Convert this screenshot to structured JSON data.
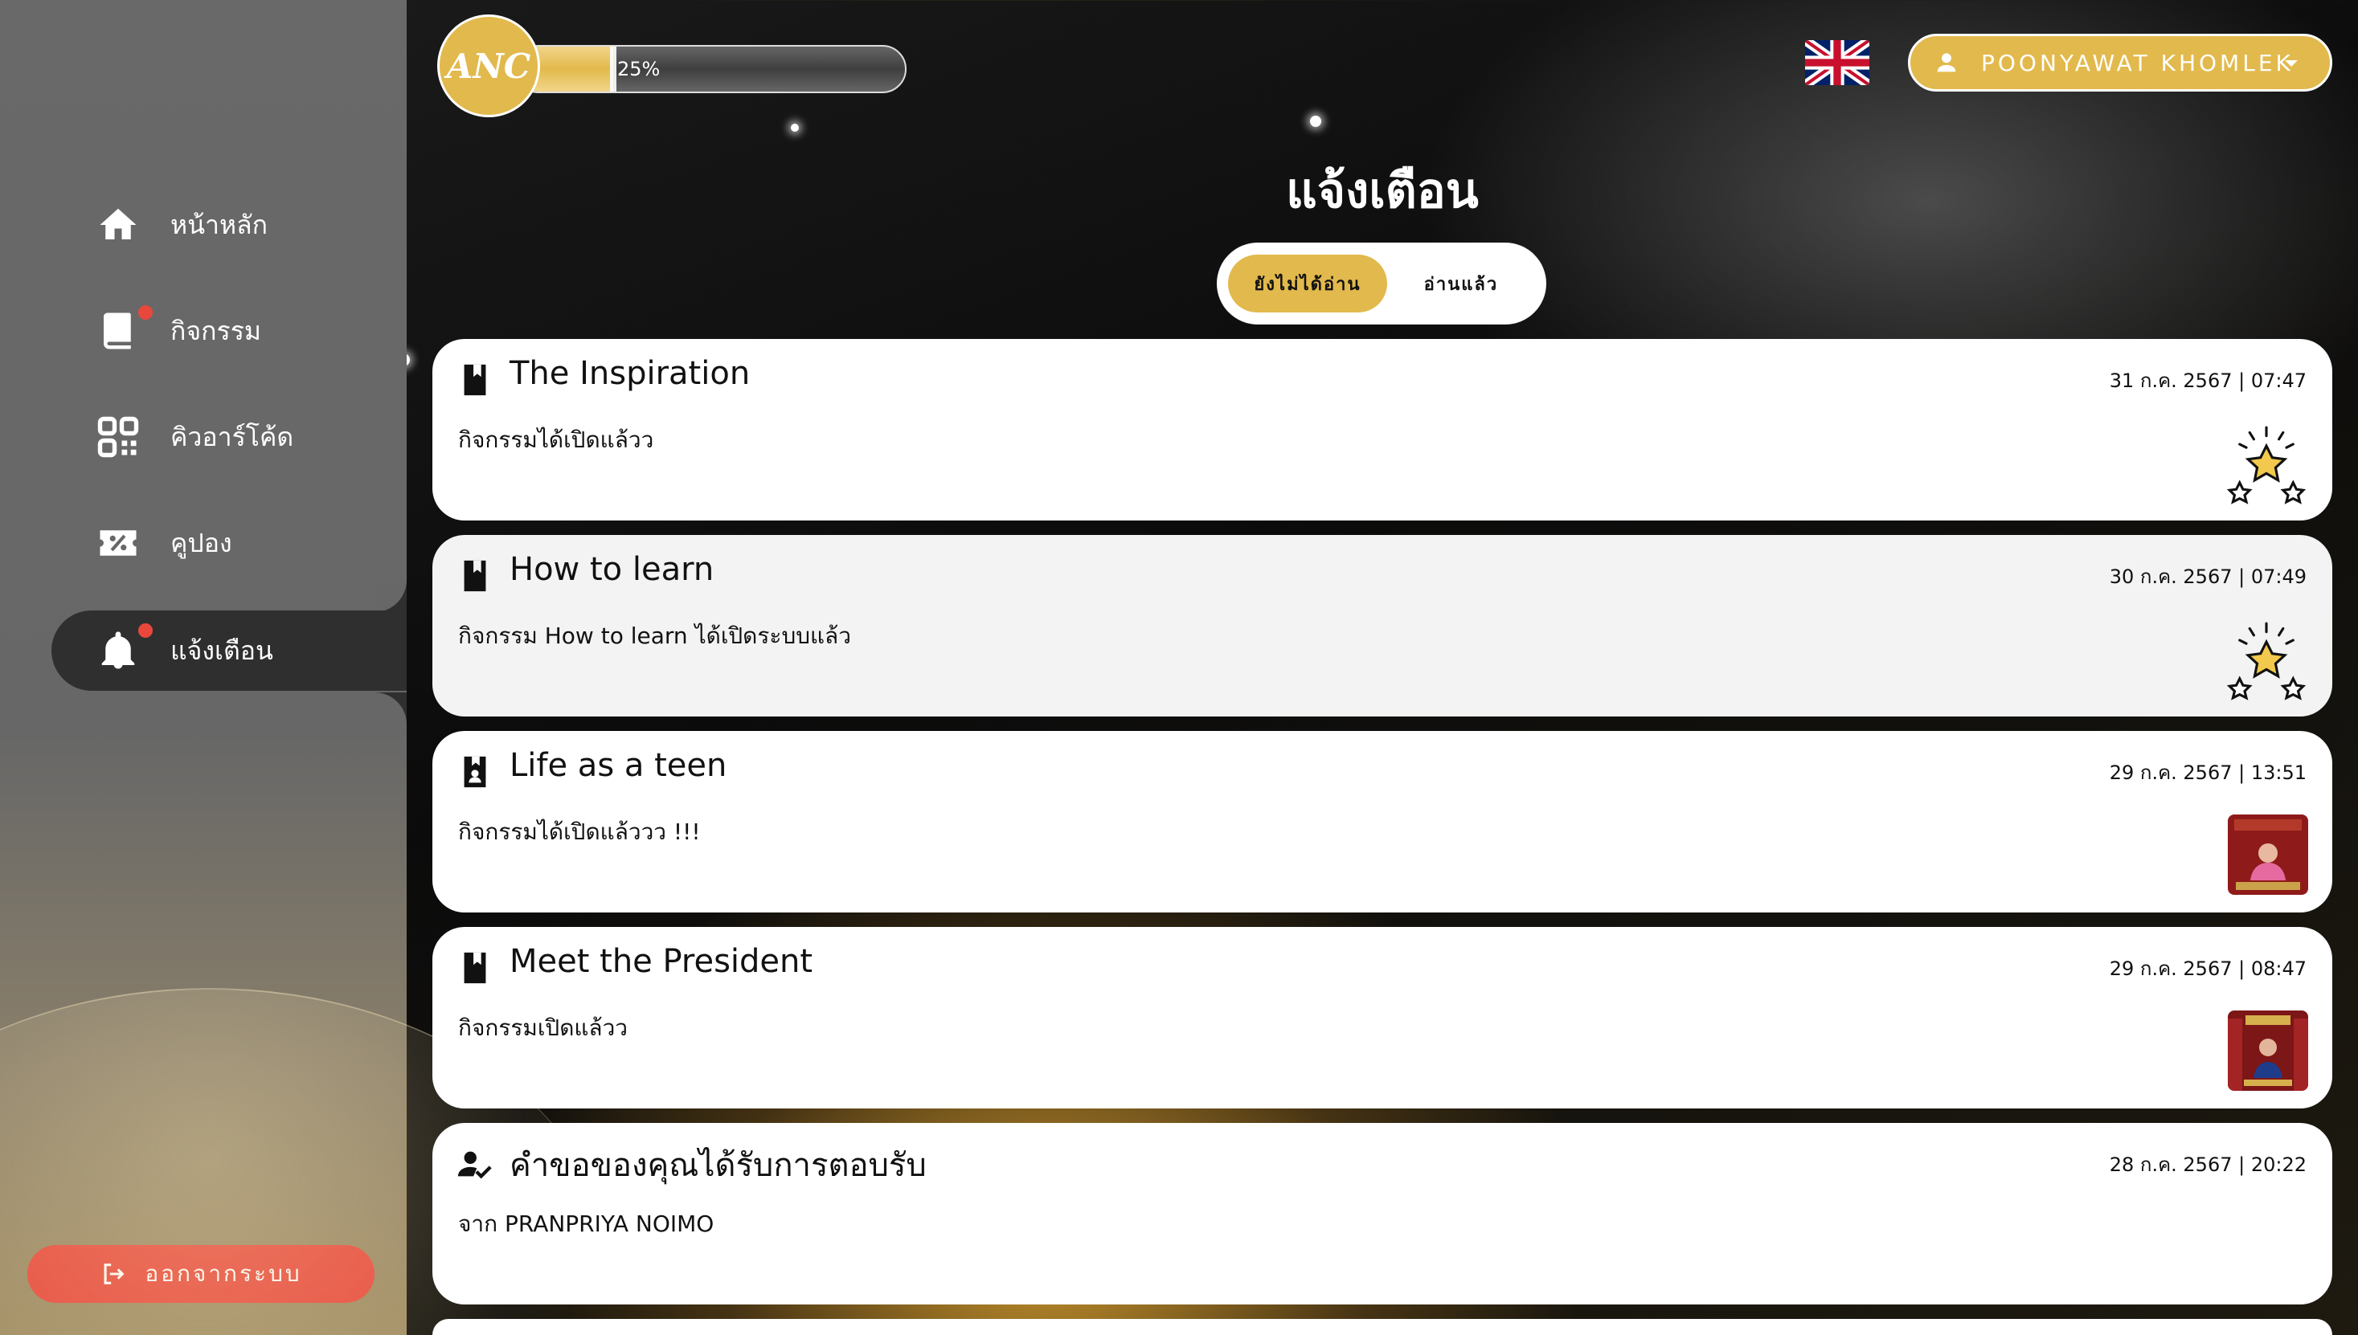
{
  "header": {
    "logo_text": "ANC",
    "progress_value": 0.25,
    "progress_label": "25%",
    "language_flag": "uk-flag-icon",
    "user_name": "POONYAWAT KHOMLEK"
  },
  "sidebar": {
    "items": [
      {
        "label": "หน้าหลัก",
        "icon": "home-icon"
      },
      {
        "label": "กิจกรรม",
        "icon": "book-icon",
        "badge": true
      },
      {
        "label": "คิวอาร์โค้ด",
        "icon": "qr-code-icon"
      },
      {
        "label": "คูปอง",
        "icon": "coupon-icon"
      },
      {
        "label": "แจ้งเตือน",
        "icon": "bell-icon",
        "badge": true,
        "active": true
      }
    ],
    "logout_label": "ออกจากระบบ"
  },
  "page": {
    "title": "แจ้งเตือน",
    "tabs": [
      {
        "label": "ยังไม่ได้อ่าน",
        "active": true
      },
      {
        "label": "อ่านแล้ว",
        "active": false
      }
    ]
  },
  "notifications": [
    {
      "title": "The Inspiration",
      "date": "31 ก.ค. 2567 | 07:47",
      "message": "กิจกรรมได้เปิดแล้วว",
      "icon": "bookmark-icon",
      "thumb": "stars-icon"
    },
    {
      "title": "How to learn",
      "date": "30 ก.ค. 2567 | 07:49",
      "message": "กิจกรรม How to learn ได้เปิดระบบแล้ว",
      "icon": "bookmark-icon",
      "thumb": "stars-icon"
    },
    {
      "title": "Life as a teen",
      "date": "29 ก.ค. 2567 | 13:51",
      "message": "กิจกรรมได้เปิดแล้ววว !!!",
      "icon": "contact-book-icon",
      "thumb": "event-photo"
    },
    {
      "title": "Meet the President",
      "date": "29 ก.ค. 2567 | 08:47",
      "message": "กิจกรรมเปิดแล้วว",
      "icon": "bookmark-icon",
      "thumb": "event-photo"
    },
    {
      "title": "คำขอของคุณได้รับการตอบรับ",
      "date": "28 ก.ค. 2567 | 20:22",
      "message": "จาก PRANPRIYA NOIMO",
      "icon": "user-check-icon"
    }
  ],
  "colors": {
    "accent": "#e2b94c",
    "danger": "#e8473c",
    "sidebar": "#676767",
    "active_nav": "#2f2f2f"
  }
}
